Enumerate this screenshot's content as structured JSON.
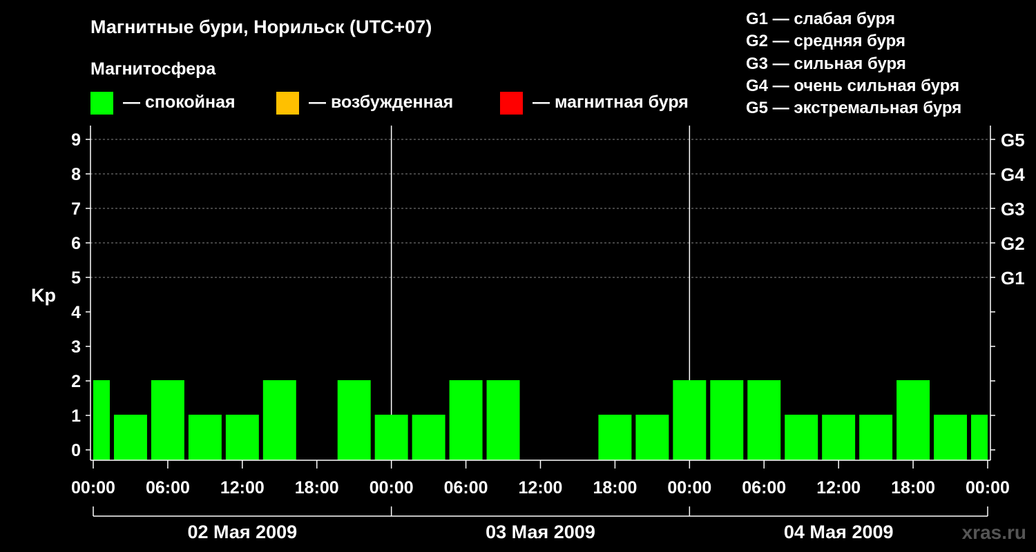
{
  "header": {
    "title": "Магнитные бури, Норильск (UTC+07)",
    "subtitle": "Магнитосфера"
  },
  "legend": {
    "items": [
      {
        "label": "— спокойная",
        "color": "#00ff00"
      },
      {
        "label": "— возбужденная",
        "color": "#ffc000"
      },
      {
        "label": "— магнитная буря",
        "color": "#ff0000"
      }
    ]
  },
  "g_legend": [
    "G1 — слабая буря",
    "G2 — средняя буря",
    "G3 — сильная буря",
    "G4 — очень сильная буря",
    "G5 — экстремальная буря"
  ],
  "watermark": "xras.ru",
  "chart_data": {
    "type": "bar",
    "ylabel": "Kp",
    "ylim": [
      0,
      9
    ],
    "y_ticks": [
      "0",
      "1",
      "2",
      "3",
      "4",
      "5",
      "6",
      "7",
      "8",
      "9"
    ],
    "right_ticks": [
      {
        "value": 5,
        "label": "G1"
      },
      {
        "value": 6,
        "label": "G2"
      },
      {
        "value": 7,
        "label": "G3"
      },
      {
        "value": 8,
        "label": "G4"
      },
      {
        "value": 9,
        "label": "G5"
      }
    ],
    "x_tick_labels": [
      "00:00",
      "06:00",
      "12:00",
      "18:00",
      "00:00",
      "06:00",
      "12:00",
      "18:00",
      "00:00",
      "06:00",
      "12:00",
      "18:00",
      "00:00"
    ],
    "days": [
      "02 Мая 2009",
      "03 Мая 2009",
      "04 Мая 2009"
    ],
    "bar_interval_hours": 3,
    "grid": "dashed lines at Kp 5–9",
    "bar_color": "#00ff00",
    "values": [
      2,
      1,
      2,
      1,
      1,
      2,
      0,
      2,
      1,
      1,
      2,
      2,
      0,
      0,
      1,
      1,
      2,
      2,
      2,
      1,
      1,
      1,
      2,
      1,
      1
    ]
  }
}
